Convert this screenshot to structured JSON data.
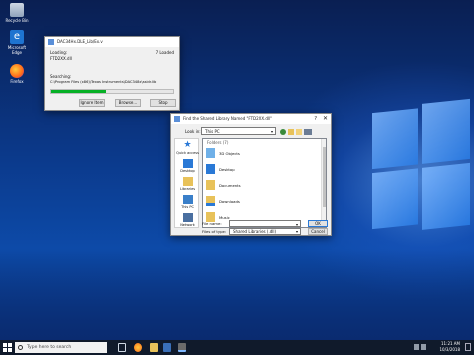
{
  "desktop": {
    "icons": [
      {
        "name": "recycle-bin-icon",
        "label": "Recycle Bin"
      },
      {
        "name": "edge-icon",
        "label": "Microsoft Edge"
      },
      {
        "name": "firefox-icon",
        "label": "Firefox"
      }
    ]
  },
  "loader": {
    "title": "DAC34Hx.DLE_Lib/Ex.v",
    "loading_label": "Loading:",
    "loading_file": "FTD2XX.dll",
    "loading_status": "7 Loaded",
    "searching_label": "Searching:",
    "searching_path": "C:\\Program Files (x86)\\Texas Instruments\\DAC348x\\ssidr.lib",
    "progress": 0.45,
    "buttons": {
      "ignore": "Ignore Item",
      "browse": "Browse...",
      "stop": "Stop"
    }
  },
  "find_dialog": {
    "title": "Find the Shared Library Named \"FTD2XX.dll\"",
    "help": "?",
    "close": "✕",
    "look_in_label": "Look in:",
    "look_in_value": "This PC",
    "folders_header": "Folders (7)",
    "places": [
      "Quick access",
      "Desktop",
      "Libraries",
      "This PC",
      "Network"
    ],
    "files": [
      "3D Objects",
      "Desktop",
      "Documents",
      "Downloads",
      "Music"
    ],
    "file_name_label": "File name:",
    "file_name_value": "",
    "files_of_type_label": "Files of type:",
    "files_of_type_value": "Shared Libraries (.dll)",
    "ok_label": "OK",
    "cancel_label": "Cancel"
  },
  "taskbar": {
    "search_placeholder": "Type here to search",
    "time": "11:21 AM",
    "date": "10/3/2018"
  }
}
